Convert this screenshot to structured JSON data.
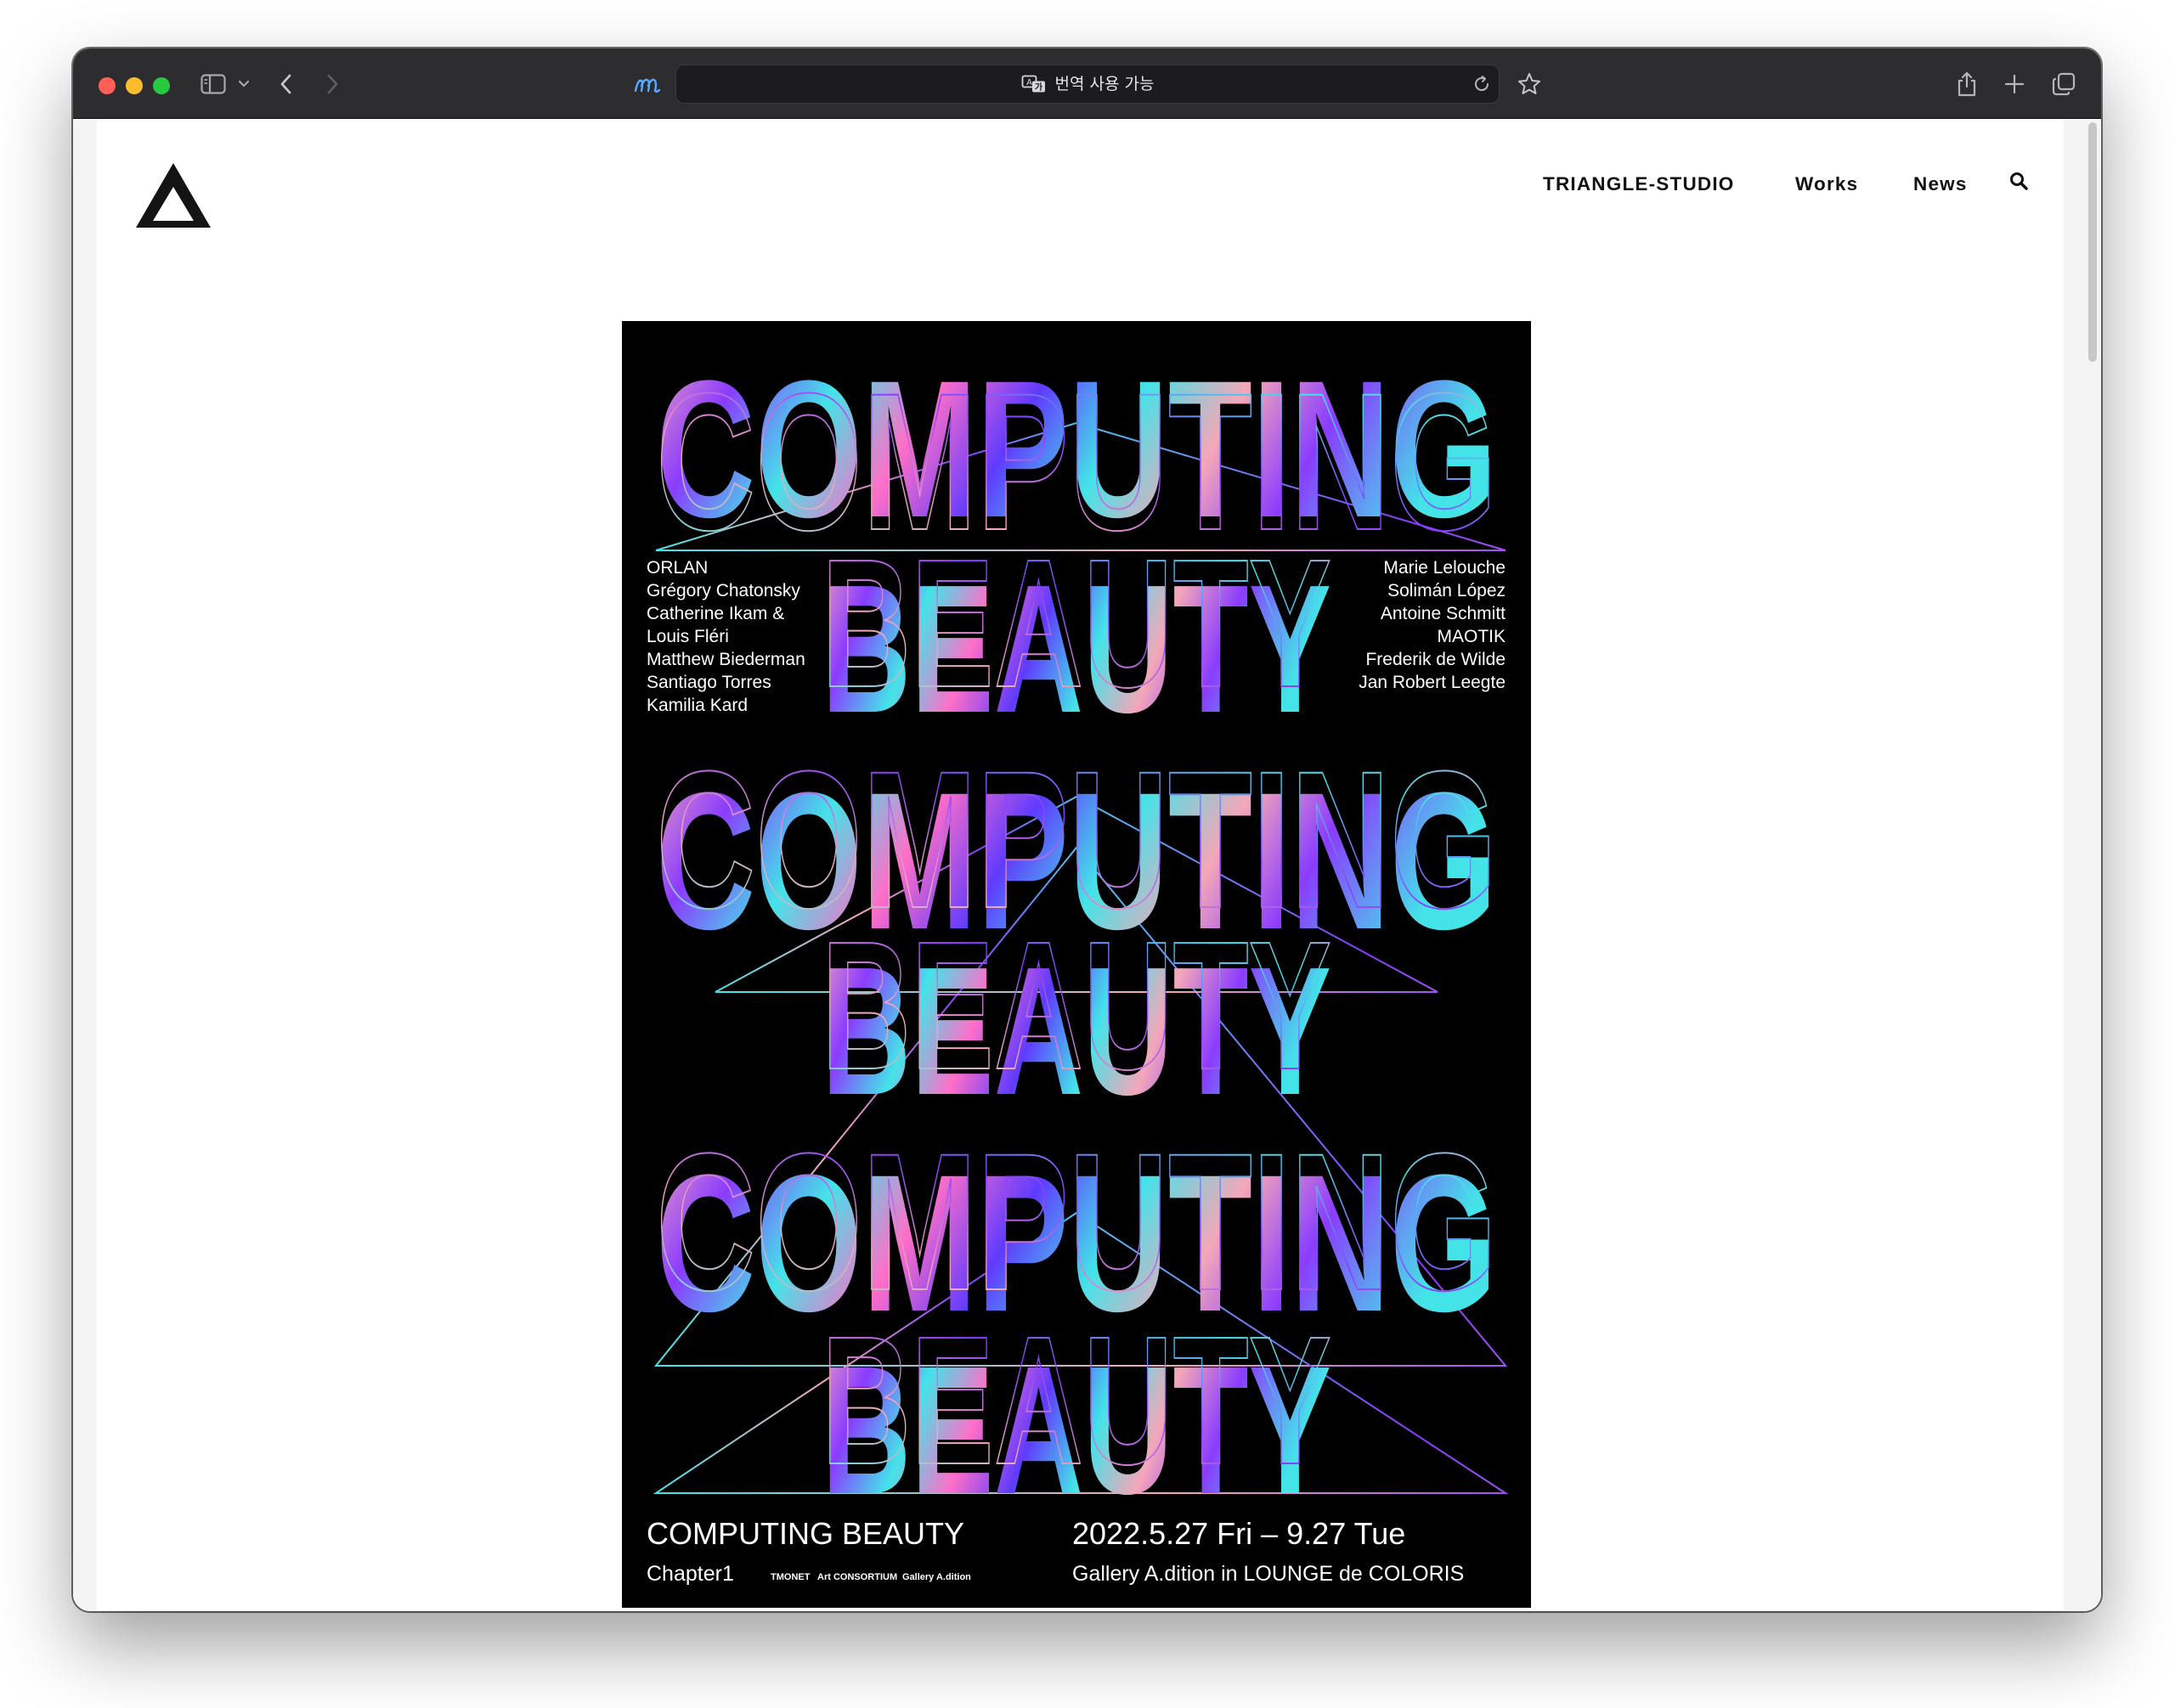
{
  "browser": {
    "url_text": "번역 사용 가능",
    "colors": {
      "chrome": "#2d2d2f",
      "field": "#1c1c1e",
      "close": "#ff5f57",
      "minimize": "#febc2e",
      "zoom": "#28c840"
    },
    "icons": [
      "sidebar-icon",
      "chevron-down-icon",
      "back-icon",
      "forward-icon",
      "extension-icon",
      "translate-icon",
      "reload-icon",
      "star-icon",
      "share-icon",
      "plus-icon",
      "tabs-icon"
    ]
  },
  "site": {
    "nav": {
      "brand": "TRIANGLE-STUDIO",
      "works": "Works",
      "news": "News"
    },
    "icons": [
      "triangle-logo-icon",
      "search-icon"
    ]
  },
  "poster": {
    "headline_words": [
      "COMPUTING",
      "BEAUTY"
    ],
    "artists_left": [
      "ORLAN",
      "Grégory Chatonsky",
      "Catherine Ikam &",
      "Louis Fléri",
      "Matthew Biederman",
      "Santiago Torres",
      "Kamilia Kard"
    ],
    "artists_right": [
      "Marie Lelouche",
      "Solimán López",
      "Antoine Schmitt",
      "MAOTIK",
      "Frederik de Wilde",
      "Jan Robert Leegte"
    ],
    "title": "COMPUTING BEAUTY",
    "chapter": "Chapter1",
    "sponsors": [
      "TMONET",
      "Art CONSORTIUM",
      "Gallery A.dition"
    ],
    "dates": "2022.5.27 Fri – 9.27 Tue",
    "venue": "Gallery A.dition in LOUNGE de COLORIS",
    "gradient_colors": [
      "#f4a7b9",
      "#8a3cff",
      "#44e3e8",
      "#ff6fc8",
      "#5f3bff"
    ]
  }
}
